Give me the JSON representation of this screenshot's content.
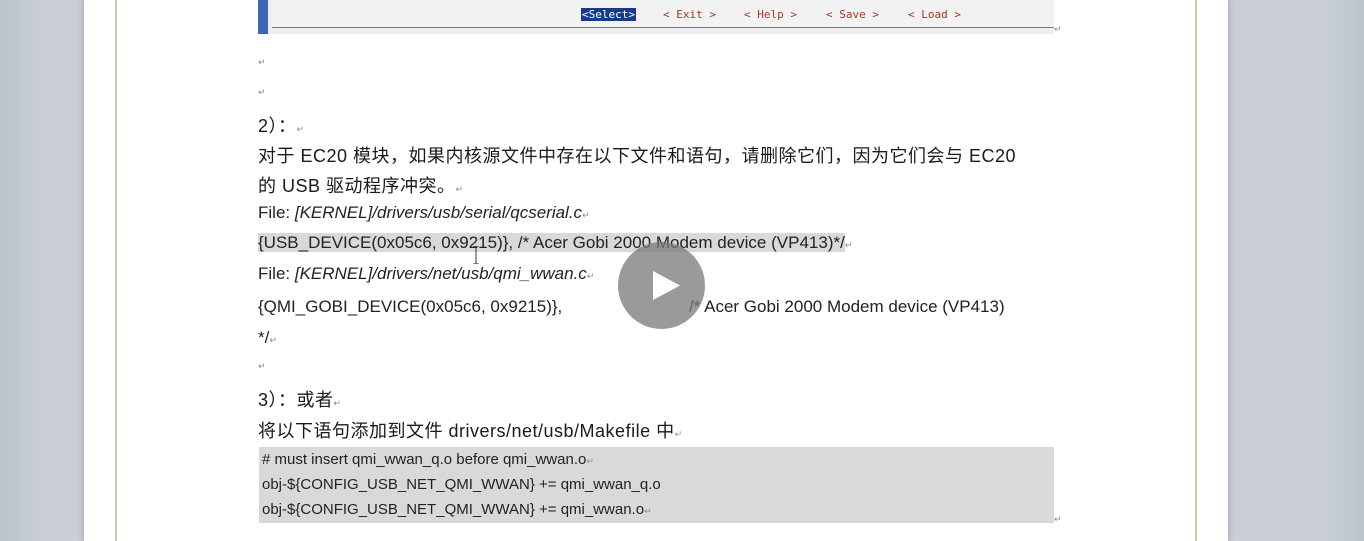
{
  "menubar": {
    "select": "<Select>",
    "exit": "< Exit >",
    "help": "< Help >",
    "save": "< Save >",
    "load": "< Load >"
  },
  "doc": {
    "step2": "2）：",
    "step2_desc_line1": "对于 EC20 模块，如果内核源文件中存在以下文件和语句，请删除它们，因为它们会与 EC20",
    "step2_desc_line2": "的 USB 驱动程序冲突。",
    "file1_label": "File: ",
    "file1_path": "[KERNEL]/drivers/usb/serial/qcserial.c",
    "file1_code": "{USB_DEVICE(0x05c6, 0x9215)}, /* Acer Gobi 2000 Modem device (VP413)*/",
    "file2_label": "File: ",
    "file2_path": "[KERNEL]/drivers/net/usb/qmi_wwan.c",
    "file2_code_a": "{QMI_GOBI_DEVICE(0x05c6, 0x9215)},",
    "file2_code_b": "/* Acer Gobi 2000 Modem device (VP413)",
    "file2_code_c": "*/",
    "step3": "3）：或者",
    "step3_desc": "将以下语句添加到文件 drivers/net/usb/Makefile   中",
    "makefile": [
      "# must insert qmi_wwan_q.o before qmi_wwan.o",
      "obj-${CONFIG_USB_NET_QMI_WWAN} += qmi_wwan_q.o",
      "obj-${CONFIG_USB_NET_QMI_WWAN} += qmi_wwan.o"
    ]
  },
  "marks": {
    "para": "↵"
  },
  "colors": {
    "select_bg": "#173a8a",
    "menubar_accent": "#3b66b3",
    "code_highlight": "#d9d9d9"
  },
  "icons": {
    "play": "play-icon"
  }
}
